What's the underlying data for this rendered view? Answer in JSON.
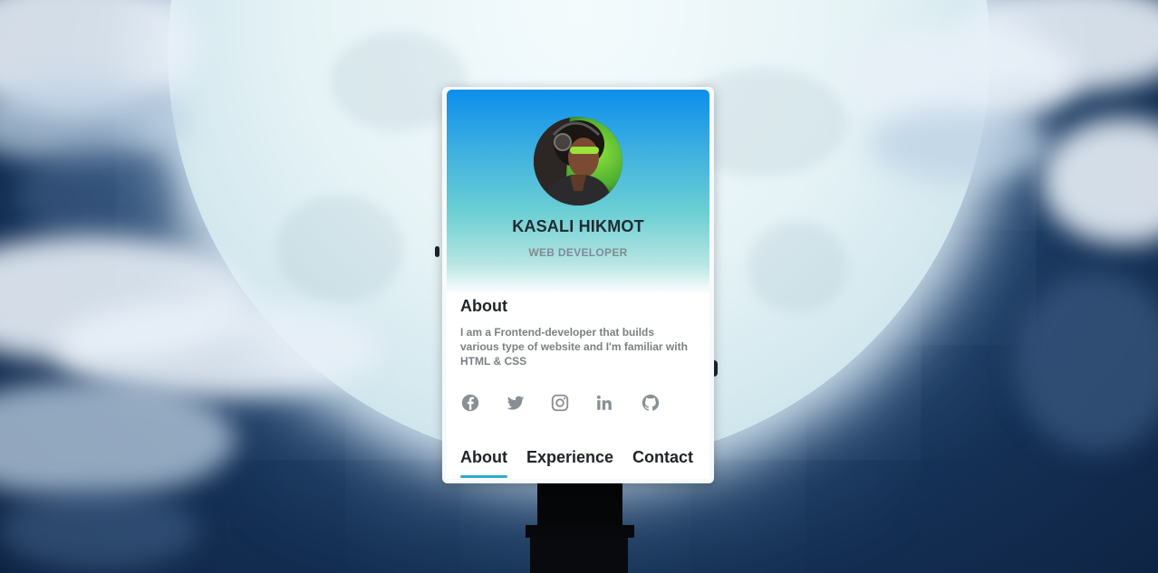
{
  "profile": {
    "name": "KASALI HIKMOT",
    "role": "WEB DEVELOPER",
    "avatar": "avatar-photo"
  },
  "about": {
    "title": "About",
    "text": "I am a Frontend-developer that builds various type of website and I'm familiar with HTML & CSS"
  },
  "socials": [
    {
      "name": "facebook",
      "icon": "facebook-icon"
    },
    {
      "name": "twitter",
      "icon": "twitter-icon"
    },
    {
      "name": "instagram",
      "icon": "instagram-icon"
    },
    {
      "name": "linkedin",
      "icon": "linkedin-icon"
    },
    {
      "name": "github",
      "icon": "github-icon"
    }
  ],
  "tabs": [
    {
      "label": "About",
      "active": true
    },
    {
      "label": "Experience",
      "active": false
    },
    {
      "label": "Contact",
      "active": false
    }
  ],
  "colors": {
    "header_top": "#0c8fec",
    "header_mid": "#6bcfd3",
    "accent": "#2ea9d6",
    "icon": "#8a8f94",
    "text_dark": "#1f2428",
    "text_muted": "#7b7f84"
  }
}
